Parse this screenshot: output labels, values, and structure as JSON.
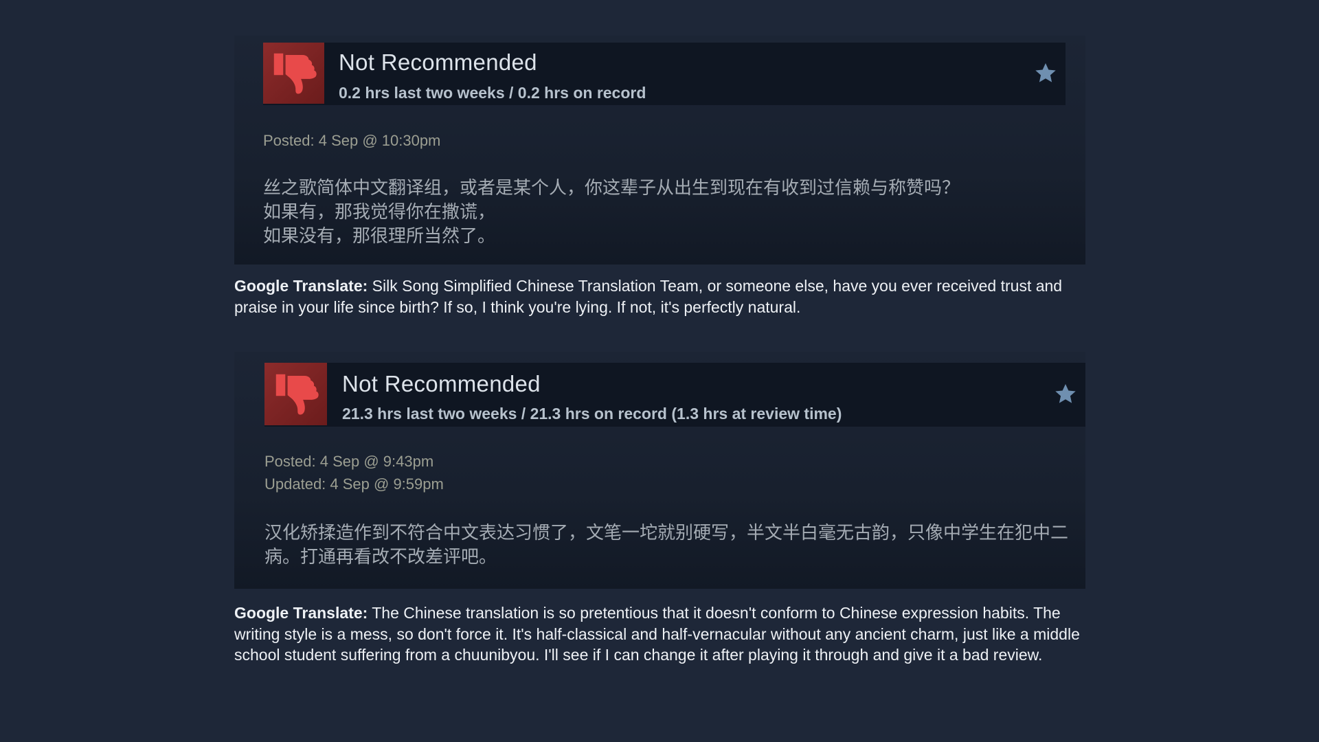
{
  "reviews": [
    {
      "verdict": "Not Recommended",
      "hours": "0.2 hrs last two weeks / 0.2 hrs on record",
      "posted": "Posted: 4 Sep @ 10:30pm",
      "content_lines": [
        "丝之歌简体中文翻译组，或者是某个人，你这辈子从出生到现在有收到过信赖与称赞吗？",
        "如果有，那我觉得你在撒谎，",
        "如果没有，那很理所当然了。"
      ],
      "translation_label": "Google Translate:",
      "translation_text": " Silk Song Simplified Chinese Translation Team, or someone else, have you ever received trust and praise in your life since birth? If so, I think you're lying. If not, it's perfectly natural."
    },
    {
      "verdict": "Not Recommended",
      "hours": "21.3 hrs last two weeks / 21.3 hrs on record (1.3 hrs at review time)",
      "posted": "Posted: 4 Sep @ 9:43pm",
      "updated": "Updated: 4 Sep @ 9:59pm",
      "content_lines": [
        "汉化矫揉造作到不符合中文表达习惯了，文笔一坨就别硬写，半文半白毫无古韵，只像中学生在犯中二病。打通再看改不改差评吧。"
      ],
      "translation_label": "Google Translate:",
      "translation_text": " The Chinese translation is so pretentious that it doesn't conform to Chinese expression habits. The writing style is a mess, so don't force it. It's half-classical and half-vernacular without any ancient charm, just like a middle school student suffering from a chuunibyou. I'll see if I can change it after playing it through and give it a bad review."
    }
  ],
  "icons": {
    "verdict": "thumbs-down-icon",
    "award": "star-icon"
  },
  "colors": {
    "background": "#1e2738",
    "thumb_bg": "#8c2b2b",
    "thumb_fg": "#e84a4a",
    "star": "#6f8fb0"
  }
}
